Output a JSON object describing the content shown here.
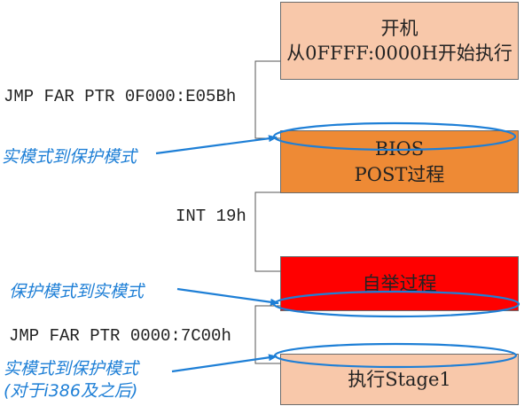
{
  "boxes": [
    {
      "line1": "开机",
      "line2": "从0FFFF:0000H开始执行",
      "fill": "#f8c8aa"
    },
    {
      "line1": "BIOS",
      "line2": "POST过程",
      "fill": "#ee8a35"
    },
    {
      "line1": "自举过程",
      "fill": "#ff0000"
    },
    {
      "line1": "执行Stage1",
      "fill": "#f8c8aa"
    }
  ],
  "jumps": [
    "JMP FAR PTR 0F000:E05Bh",
    "INT 19h",
    "JMP FAR PTR 0000:7C00h"
  ],
  "annotations": [
    {
      "text": "实模式到保护模式"
    },
    {
      "text": "保护模式到实模式"
    },
    {
      "text": "实模式到保护模式",
      "sub": "(对于i386及之后)"
    }
  ],
  "colors": {
    "annotation": "#1e7fd6",
    "connector": "#555555",
    "box_border": "#6b6b6b"
  }
}
